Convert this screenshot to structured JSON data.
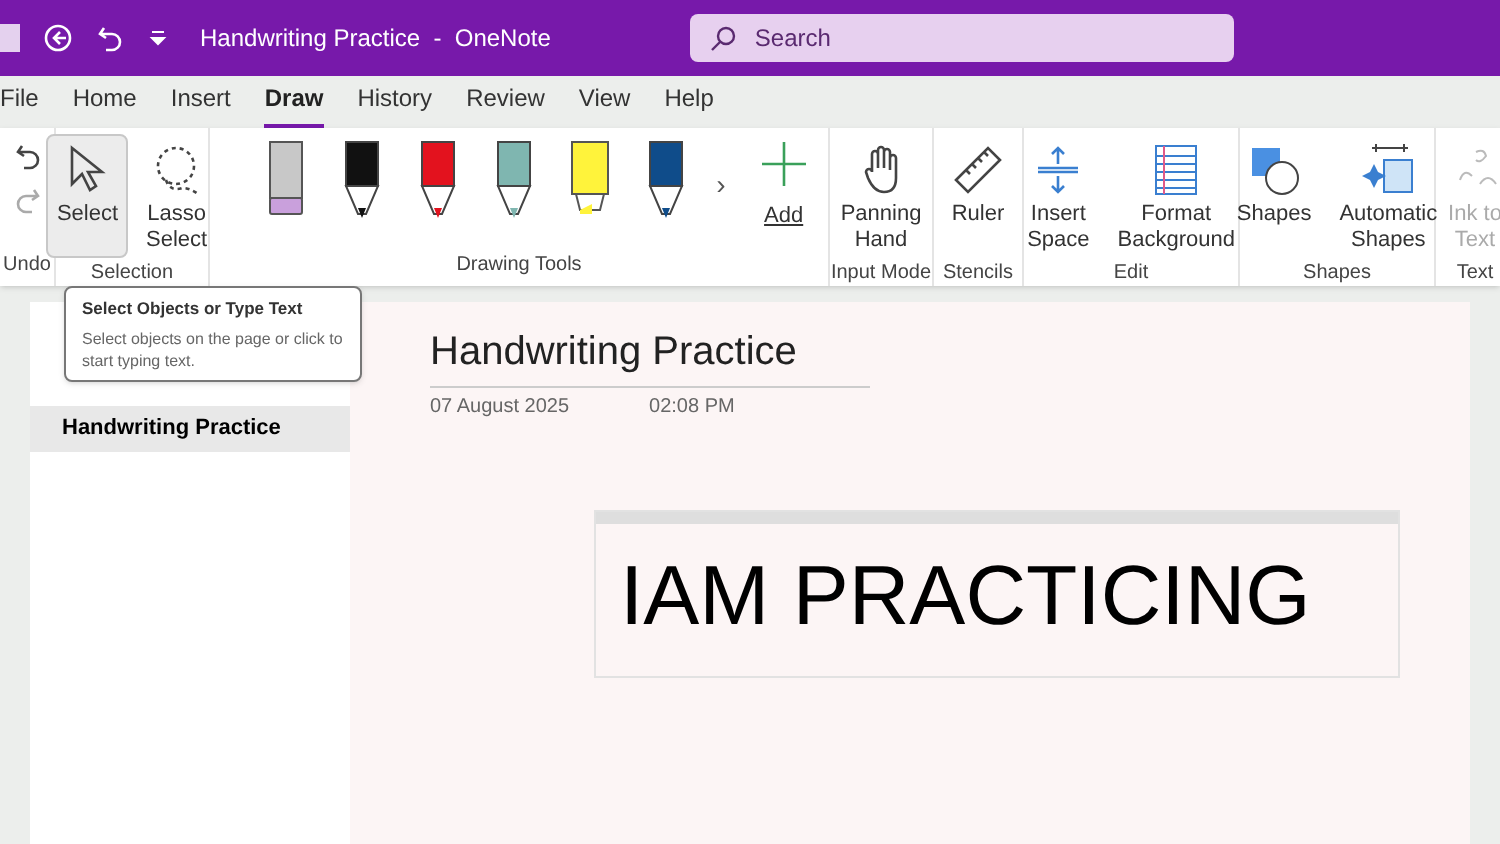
{
  "window": {
    "title": "Handwriting Practice  -  OneNote"
  },
  "search": {
    "placeholder": "Search"
  },
  "tabs": [
    {
      "label": "File",
      "selected": false
    },
    {
      "label": "Home",
      "selected": false
    },
    {
      "label": "Insert",
      "selected": false
    },
    {
      "label": "Draw",
      "selected": true
    },
    {
      "label": "History",
      "selected": false
    },
    {
      "label": "Review",
      "selected": false
    },
    {
      "label": "View",
      "selected": false
    },
    {
      "label": "Help",
      "selected": false
    }
  ],
  "ribbon": {
    "groups": [
      {
        "label": "Undo",
        "buttons": [
          {
            "kind": "undo",
            "disabled": false
          },
          {
            "kind": "redo",
            "disabled": true
          }
        ]
      },
      {
        "label": "Selection",
        "buttons": [
          {
            "kind": "select",
            "label": "Select",
            "selected": true
          },
          {
            "kind": "lasso",
            "label": "Lasso Select",
            "selected": false
          }
        ]
      },
      {
        "label": "Drawing Tools",
        "pens": [
          {
            "kind": "eraser",
            "color": "#c9a0dc"
          },
          {
            "kind": "pen",
            "color": "#111111"
          },
          {
            "kind": "pen",
            "color": "#e3121e"
          },
          {
            "kind": "galaxy",
            "color": "#7fb6b0"
          },
          {
            "kind": "highlighter",
            "color": "#fff33b"
          },
          {
            "kind": "fountain",
            "color": "#0f4c8a"
          }
        ],
        "more": "›",
        "add": "Add"
      },
      {
        "label": "Input Mode",
        "buttons": [
          {
            "kind": "hand",
            "label": "Panning Hand"
          }
        ]
      },
      {
        "label": "Stencils",
        "buttons": [
          {
            "kind": "ruler",
            "label": "Ruler"
          }
        ]
      },
      {
        "label": "Edit",
        "buttons": [
          {
            "kind": "space",
            "label": "Insert Space"
          },
          {
            "kind": "background",
            "label": "Format Background"
          }
        ]
      },
      {
        "label": "Shapes",
        "buttons": [
          {
            "kind": "shapes",
            "label": "Shapes"
          },
          {
            "kind": "auto",
            "label": "Automatic Shapes"
          }
        ]
      },
      {
        "label": "Text",
        "buttons": [
          {
            "kind": "ink",
            "label": "Ink to Text",
            "disabled": true
          }
        ]
      }
    ]
  },
  "tooltip": {
    "title": "Select Objects or Type Text",
    "text": "Select objects on the page or click to start typing text."
  },
  "pages": [
    {
      "label": "Handwriting Practice",
      "selected": true
    }
  ],
  "page": {
    "title": "Handwriting Practice",
    "date": "07 August 2025",
    "time": "02:08 PM",
    "note": "IAM PRACTICING"
  }
}
